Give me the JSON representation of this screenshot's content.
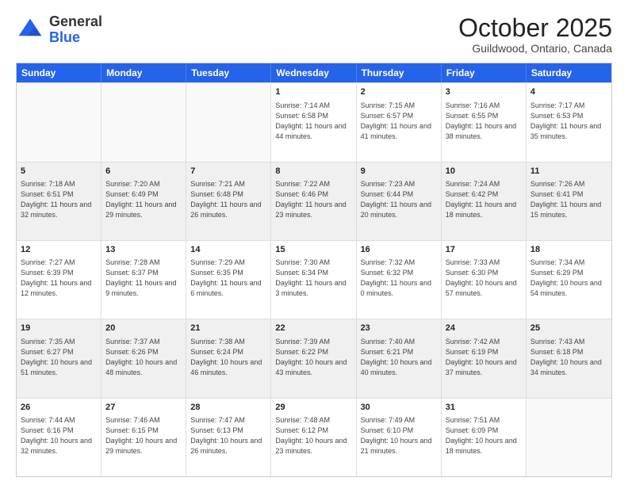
{
  "header": {
    "logo": {
      "general": "General",
      "blue": "Blue"
    },
    "title": "October 2025",
    "location": "Guildwood, Ontario, Canada"
  },
  "days_of_week": [
    "Sunday",
    "Monday",
    "Tuesday",
    "Wednesday",
    "Thursday",
    "Friday",
    "Saturday"
  ],
  "weeks": [
    [
      {
        "day": "",
        "empty": true
      },
      {
        "day": "",
        "empty": true
      },
      {
        "day": "",
        "empty": true
      },
      {
        "day": "1",
        "sunrise": "7:14 AM",
        "sunset": "6:58 PM",
        "daylight": "11 hours and 44 minutes."
      },
      {
        "day": "2",
        "sunrise": "7:15 AM",
        "sunset": "6:57 PM",
        "daylight": "11 hours and 41 minutes."
      },
      {
        "day": "3",
        "sunrise": "7:16 AM",
        "sunset": "6:55 PM",
        "daylight": "11 hours and 38 minutes."
      },
      {
        "day": "4",
        "sunrise": "7:17 AM",
        "sunset": "6:53 PM",
        "daylight": "11 hours and 35 minutes."
      }
    ],
    [
      {
        "day": "5",
        "sunrise": "7:18 AM",
        "sunset": "6:51 PM",
        "daylight": "11 hours and 32 minutes."
      },
      {
        "day": "6",
        "sunrise": "7:20 AM",
        "sunset": "6:49 PM",
        "daylight": "11 hours and 29 minutes."
      },
      {
        "day": "7",
        "sunrise": "7:21 AM",
        "sunset": "6:48 PM",
        "daylight": "11 hours and 26 minutes."
      },
      {
        "day": "8",
        "sunrise": "7:22 AM",
        "sunset": "6:46 PM",
        "daylight": "11 hours and 23 minutes."
      },
      {
        "day": "9",
        "sunrise": "7:23 AM",
        "sunset": "6:44 PM",
        "daylight": "11 hours and 20 minutes."
      },
      {
        "day": "10",
        "sunrise": "7:24 AM",
        "sunset": "6:42 PM",
        "daylight": "11 hours and 18 minutes."
      },
      {
        "day": "11",
        "sunrise": "7:26 AM",
        "sunset": "6:41 PM",
        "daylight": "11 hours and 15 minutes."
      }
    ],
    [
      {
        "day": "12",
        "sunrise": "7:27 AM",
        "sunset": "6:39 PM",
        "daylight": "11 hours and 12 minutes."
      },
      {
        "day": "13",
        "sunrise": "7:28 AM",
        "sunset": "6:37 PM",
        "daylight": "11 hours and 9 minutes."
      },
      {
        "day": "14",
        "sunrise": "7:29 AM",
        "sunset": "6:35 PM",
        "daylight": "11 hours and 6 minutes."
      },
      {
        "day": "15",
        "sunrise": "7:30 AM",
        "sunset": "6:34 PM",
        "daylight": "11 hours and 3 minutes."
      },
      {
        "day": "16",
        "sunrise": "7:32 AM",
        "sunset": "6:32 PM",
        "daylight": "11 hours and 0 minutes."
      },
      {
        "day": "17",
        "sunrise": "7:33 AM",
        "sunset": "6:30 PM",
        "daylight": "10 hours and 57 minutes."
      },
      {
        "day": "18",
        "sunrise": "7:34 AM",
        "sunset": "6:29 PM",
        "daylight": "10 hours and 54 minutes."
      }
    ],
    [
      {
        "day": "19",
        "sunrise": "7:35 AM",
        "sunset": "6:27 PM",
        "daylight": "10 hours and 51 minutes."
      },
      {
        "day": "20",
        "sunrise": "7:37 AM",
        "sunset": "6:26 PM",
        "daylight": "10 hours and 48 minutes."
      },
      {
        "day": "21",
        "sunrise": "7:38 AM",
        "sunset": "6:24 PM",
        "daylight": "10 hours and 46 minutes."
      },
      {
        "day": "22",
        "sunrise": "7:39 AM",
        "sunset": "6:22 PM",
        "daylight": "10 hours and 43 minutes."
      },
      {
        "day": "23",
        "sunrise": "7:40 AM",
        "sunset": "6:21 PM",
        "daylight": "10 hours and 40 minutes."
      },
      {
        "day": "24",
        "sunrise": "7:42 AM",
        "sunset": "6:19 PM",
        "daylight": "10 hours and 37 minutes."
      },
      {
        "day": "25",
        "sunrise": "7:43 AM",
        "sunset": "6:18 PM",
        "daylight": "10 hours and 34 minutes."
      }
    ],
    [
      {
        "day": "26",
        "sunrise": "7:44 AM",
        "sunset": "6:16 PM",
        "daylight": "10 hours and 32 minutes."
      },
      {
        "day": "27",
        "sunrise": "7:46 AM",
        "sunset": "6:15 PM",
        "daylight": "10 hours and 29 minutes."
      },
      {
        "day": "28",
        "sunrise": "7:47 AM",
        "sunset": "6:13 PM",
        "daylight": "10 hours and 26 minutes."
      },
      {
        "day": "29",
        "sunrise": "7:48 AM",
        "sunset": "6:12 PM",
        "daylight": "10 hours and 23 minutes."
      },
      {
        "day": "30",
        "sunrise": "7:49 AM",
        "sunset": "6:10 PM",
        "daylight": "10 hours and 21 minutes."
      },
      {
        "day": "31",
        "sunrise": "7:51 AM",
        "sunset": "6:09 PM",
        "daylight": "10 hours and 18 minutes."
      },
      {
        "day": "",
        "empty": true
      }
    ]
  ]
}
